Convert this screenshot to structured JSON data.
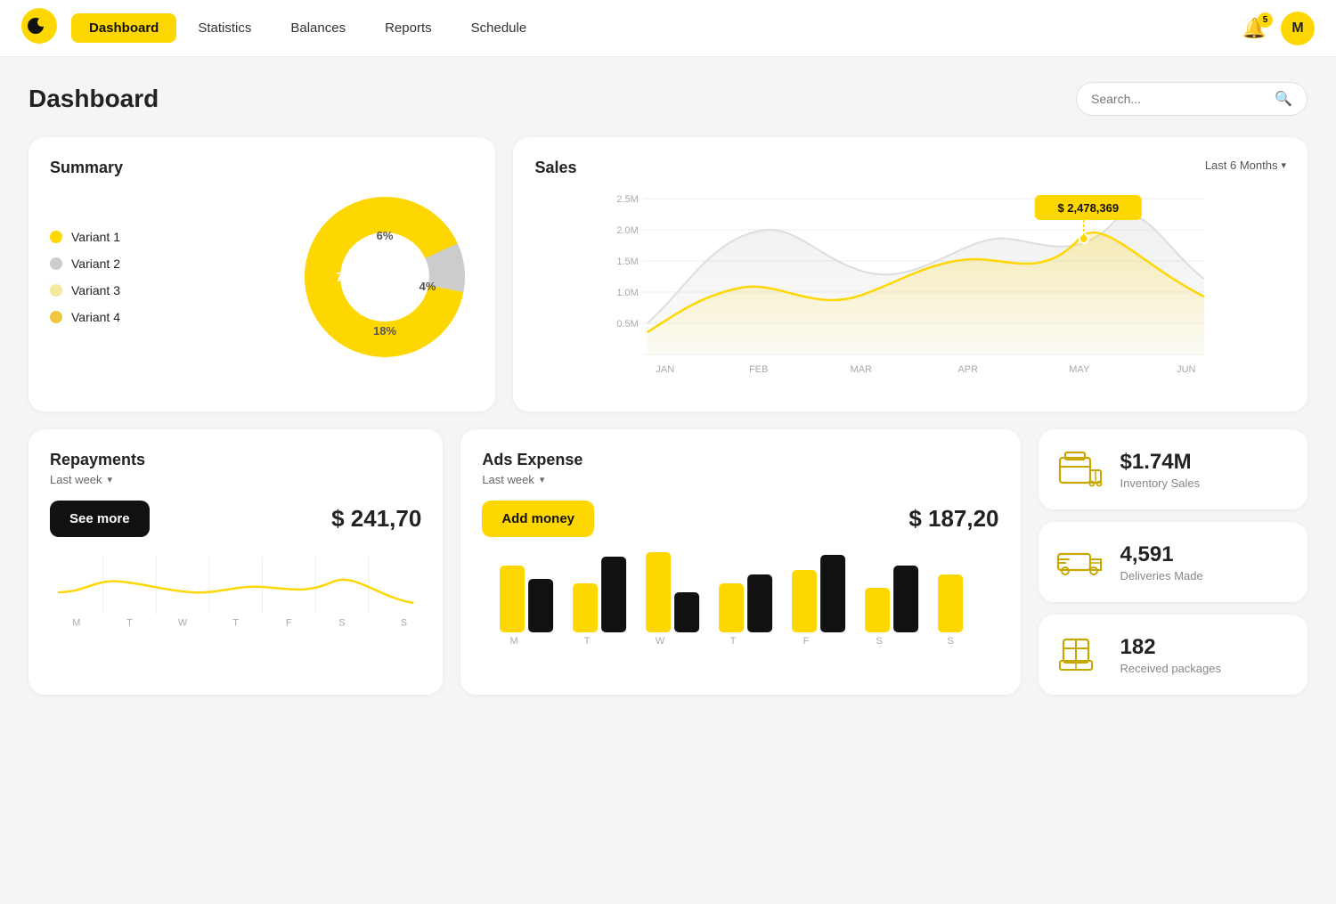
{
  "nav": {
    "items": [
      {
        "label": "Dashboard",
        "active": true
      },
      {
        "label": "Statistics",
        "active": false
      },
      {
        "label": "Balances",
        "active": false
      },
      {
        "label": "Reports",
        "active": false
      },
      {
        "label": "Schedule",
        "active": false
      }
    ],
    "bell_count": "5",
    "avatar_initial": "M"
  },
  "page": {
    "title": "Dashboard",
    "search_placeholder": "Search..."
  },
  "summary": {
    "title": "Summary",
    "variants": [
      {
        "label": "Variant 1",
        "color": "#FFD700",
        "pct": "72%"
      },
      {
        "label": "Variant 2",
        "color": "#CCCCCC",
        "pct": "18%"
      },
      {
        "label": "Variant 3",
        "color": "#F5E9A0",
        "pct": "6%"
      },
      {
        "label": "Variant 4",
        "color": "#F0C840",
        "pct": "4%"
      }
    ]
  },
  "sales": {
    "title": "Sales",
    "filter_label": "Last 6 Months",
    "peak_label": "$ 2,478,369",
    "months": [
      "JAN",
      "FEB",
      "MAR",
      "APR",
      "MAY",
      "JUN"
    ],
    "y_labels": [
      "2.5M",
      "2.0M",
      "1.5M",
      "1.0M",
      "0.5M"
    ]
  },
  "repayments": {
    "title": "Repayments",
    "period": "Last week",
    "see_more": "See more",
    "amount": "$ 241,70",
    "days": [
      "M",
      "T",
      "W",
      "T",
      "F",
      "S",
      "S"
    ]
  },
  "ads": {
    "title": "Ads Expense",
    "period": "Last week",
    "add_money": "Add money",
    "amount": "$ 187,20",
    "days": [
      "M",
      "T",
      "W",
      "T",
      "F",
      "S",
      "S"
    ]
  },
  "stats": [
    {
      "icon": "inventory-icon",
      "value": "$1.74M",
      "label": "Inventory Sales"
    },
    {
      "icon": "delivery-icon",
      "value": "4,591",
      "label": "Deliveries Made"
    },
    {
      "icon": "package-icon",
      "value": "182",
      "label": "Received packages"
    }
  ]
}
